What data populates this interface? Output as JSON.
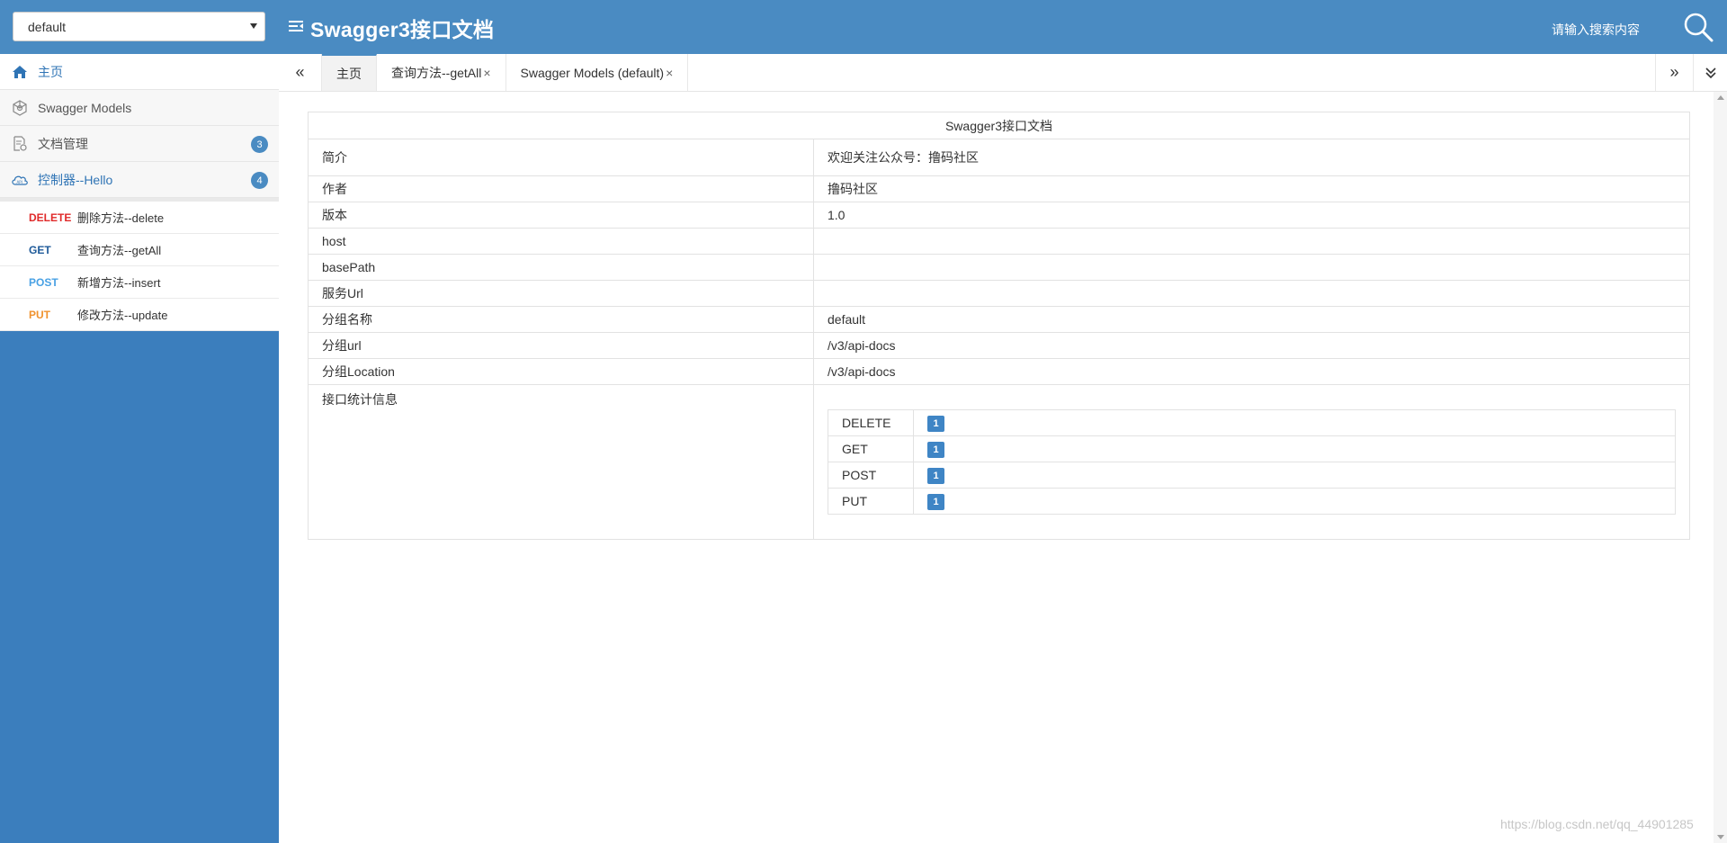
{
  "header": {
    "group_select_value": "default",
    "title": "Swagger3接口文档",
    "search_placeholder": "请输入搜索内容"
  },
  "sidebar": {
    "items": [
      {
        "label": "主页",
        "icon": "home-icon"
      },
      {
        "label": "Swagger Models",
        "icon": "cube-icon"
      },
      {
        "label": "文档管理",
        "icon": "document-settings-icon",
        "badge": "3"
      },
      {
        "label": "控制器--Hello",
        "icon": "cloud-icon",
        "badge": "4"
      }
    ],
    "endpoints": [
      {
        "method": "DELETE",
        "name": "删除方法--delete"
      },
      {
        "method": "GET",
        "name": "查询方法--getAll"
      },
      {
        "method": "POST",
        "name": "新增方法--insert"
      },
      {
        "method": "PUT",
        "name": "修改方法--update"
      }
    ]
  },
  "tabs": [
    {
      "label": "主页"
    },
    {
      "label": "查询方法--getAll",
      "close": "×"
    },
    {
      "label": "Swagger Models (default)",
      "close": "×"
    }
  ],
  "tab_nav": {
    "prev": "«",
    "next": "»"
  },
  "info": {
    "title": "Swagger3接口文档",
    "rows": [
      {
        "key": "简介",
        "value": "欢迎关注公众号：撸码社区"
      },
      {
        "key": "作者",
        "value": "撸码社区"
      },
      {
        "key": "版本",
        "value": "1.0"
      },
      {
        "key": "host",
        "value": ""
      },
      {
        "key": "basePath",
        "value": ""
      },
      {
        "key": "服务Url",
        "value": ""
      },
      {
        "key": "分组名称",
        "value": "default"
      },
      {
        "key": "分组url",
        "value": "/v3/api-docs"
      },
      {
        "key": "分组Location",
        "value": "/v3/api-docs"
      }
    ],
    "stats_label": "接口统计信息",
    "stats": [
      {
        "method": "DELETE",
        "count": "1"
      },
      {
        "method": "GET",
        "count": "1"
      },
      {
        "method": "POST",
        "count": "1"
      },
      {
        "method": "PUT",
        "count": "1"
      }
    ]
  },
  "watermark": "https://blog.csdn.net/qq_44901285",
  "colors": {
    "header": "#4a8bc2",
    "sidebar": "#3b7ebd",
    "delete": "#e02a2a",
    "get": "#1e5a99",
    "post": "#49a1e4",
    "put": "#f0922e"
  }
}
